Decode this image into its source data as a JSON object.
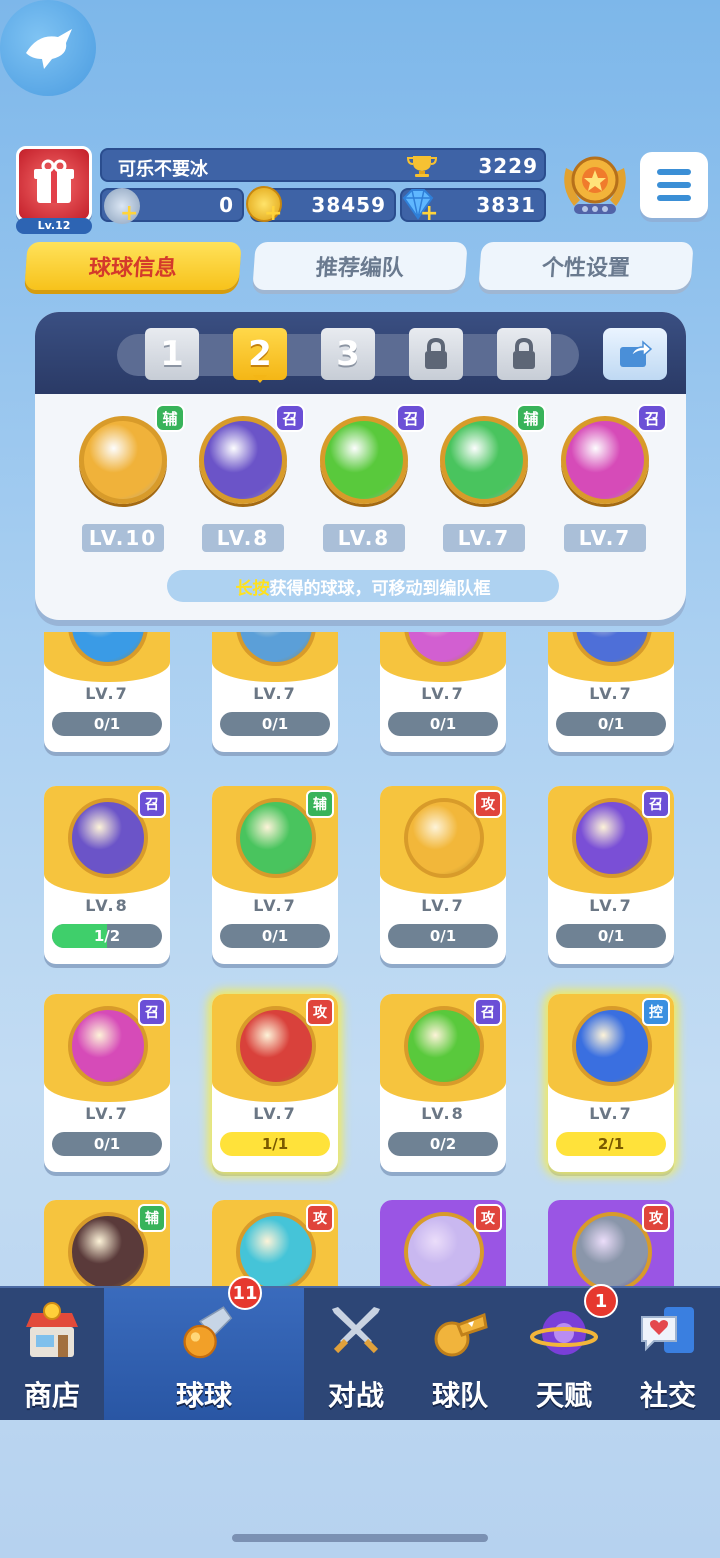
{
  "player": {
    "name": "可乐不要冰",
    "level": "Lv.12",
    "trophies": "3229"
  },
  "resources": {
    "energy": "0",
    "coins": "38459",
    "gems": "3831"
  },
  "tabs": [
    {
      "label": "球球信息"
    },
    {
      "label": "推荐编队"
    },
    {
      "label": "个性设置"
    }
  ],
  "team": {
    "slots": [
      "1",
      "2",
      "3"
    ],
    "selected_slot": "2",
    "balls": [
      {
        "type": "辅",
        "level": "LV.10",
        "color": "#f0b23a"
      },
      {
        "type": "召",
        "level": "LV.8",
        "color": "#6b54c8"
      },
      {
        "type": "召",
        "level": "LV.8",
        "color": "#59c93c"
      },
      {
        "type": "辅",
        "level": "LV.7",
        "color": "#49c45e"
      },
      {
        "type": "召",
        "level": "LV.7",
        "color": "#d64bb8"
      }
    ],
    "hint_key": "长按",
    "hint_rest": "获得的球球，可移动到编队框"
  },
  "collection": {
    "row0": [
      {
        "level": "LV.7",
        "count": "0/1",
        "color": "#3a9be6"
      },
      {
        "level": "LV.7",
        "count": "0/1",
        "color": "#5b9fd8"
      },
      {
        "level": "LV.7",
        "count": "0/1",
        "color": "#d25fd1"
      },
      {
        "level": "LV.7",
        "count": "0/1",
        "color": "#4e6fd8"
      }
    ],
    "row1": [
      {
        "type": "召",
        "level": "LV.8",
        "count": "1/2",
        "progress": 0.5,
        "color": "#6b54c8"
      },
      {
        "type": "辅",
        "level": "LV.7",
        "count": "0/1",
        "color": "#49c45e"
      },
      {
        "type": "攻",
        "level": "LV.7",
        "count": "0/1",
        "color": "#f2b73a"
      },
      {
        "type": "召",
        "level": "LV.7",
        "count": "0/1",
        "color": "#7a4fd6"
      }
    ],
    "row2": [
      {
        "type": "召",
        "level": "LV.7",
        "count": "0/1",
        "color": "#d64bb8"
      },
      {
        "type": "攻",
        "level": "LV.7",
        "count": "1/1",
        "color": "#d9413b"
      },
      {
        "type": "召",
        "level": "LV.8",
        "count": "0/2",
        "color": "#59c93c"
      },
      {
        "type": "控",
        "level": "LV.7",
        "count": "2/1",
        "color": "#3a6fe0"
      }
    ],
    "row3": [
      {
        "type": "辅",
        "color": "#5a3a3a"
      },
      {
        "type": "攻",
        "color": "#45c4d8"
      },
      {
        "type": "攻",
        "color": "#c9b8f0"
      },
      {
        "type": "攻",
        "color": "#8a96aa"
      }
    ]
  },
  "nav": [
    {
      "label": "商店"
    },
    {
      "label": "球球",
      "badge": "11"
    },
    {
      "label": "对战"
    },
    {
      "label": "球队"
    },
    {
      "label": "天赋",
      "badge": "1"
    },
    {
      "label": "社交"
    }
  ]
}
